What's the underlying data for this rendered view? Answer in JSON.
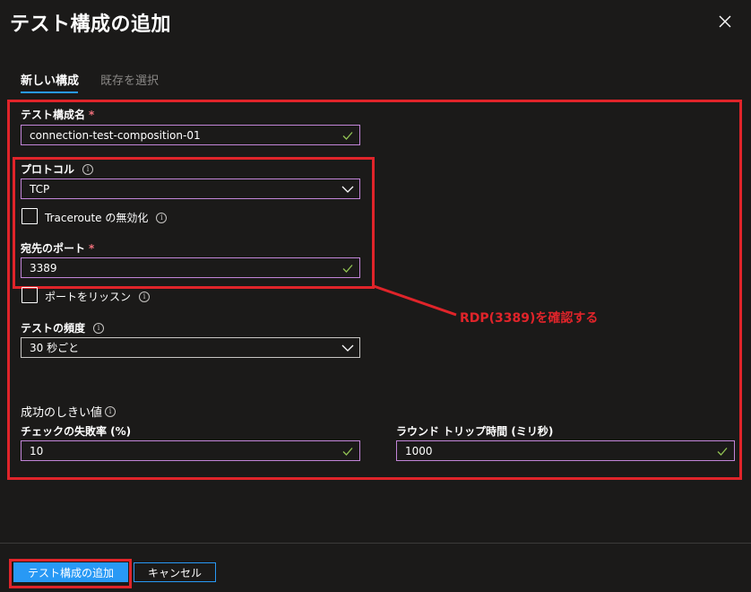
{
  "header": {
    "title": "テスト構成の追加",
    "close_icon": "close-icon"
  },
  "tabs": [
    {
      "label": "新しい構成",
      "active": true
    },
    {
      "label": "既存を選択",
      "active": false
    }
  ],
  "form": {
    "config_name": {
      "label": "テスト構成名",
      "required_mark": "*",
      "value": "connection-test-composition-01"
    },
    "protocol": {
      "label": "プロトコル",
      "value": "TCP"
    },
    "disable_traceroute": {
      "label": "Traceroute の無効化",
      "checked": false
    },
    "dest_port": {
      "label": "宛先のポート",
      "required_mark": "*",
      "value": "3389"
    },
    "listen_port": {
      "label": "ポートをリッスン",
      "checked": false
    },
    "frequency": {
      "label": "テストの頻度",
      "value": "30 秒ごと"
    },
    "success_threshold": {
      "heading": "成功のしきい値",
      "check_fail": {
        "label": "チェックの失敗率 (%)",
        "value": "10"
      },
      "round_trip": {
        "label": "ラウンド トリップ時間 (ミリ秒)",
        "value": "1000"
      }
    }
  },
  "annotation": {
    "text": "RDP(3389)を確認する",
    "color": "#e0242a"
  },
  "footer": {
    "add_label": "テスト構成の追加",
    "cancel_label": "キャンセル"
  },
  "colors": {
    "accent": "#2899f5",
    "input_border": "#c285d8",
    "check": "#92c353",
    "highlight": "#e0242a"
  }
}
